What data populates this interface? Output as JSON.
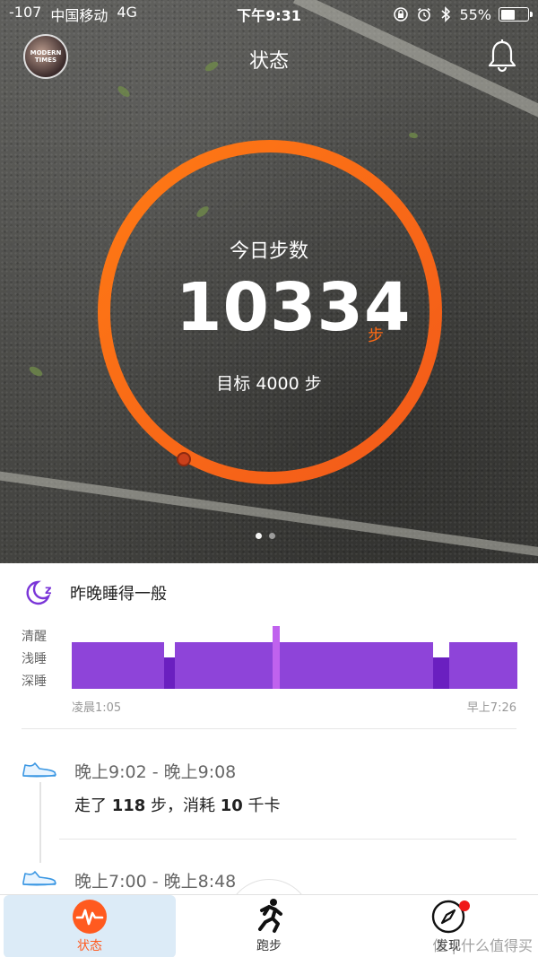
{
  "status_bar": {
    "signal": "-107",
    "carrier": "中国移动",
    "network": "4G",
    "time": "下午9:31",
    "battery": "55%",
    "battery_level": 0.55
  },
  "header": {
    "title": "状态",
    "avatar_text": "MODERN TIMES"
  },
  "steps": {
    "label": "今日步数",
    "value": "10334",
    "unit": "步",
    "goal": "目标 4000 步",
    "ring_color": "#ff6a14"
  },
  "sleep": {
    "title": "昨晚睡得一般",
    "levels": [
      "清醒",
      "浅睡",
      "深睡"
    ],
    "start": "凌晨1:05",
    "end": "早上7:26",
    "light_color": "#8e44d9",
    "deep_color": "#6a1fc0",
    "awake_color": "#c062ee"
  },
  "activities": [
    {
      "time": "晚上9:02 - 晚上9:08",
      "desc_prefix": "走了 ",
      "steps": "118",
      "desc_mid": " 步，消耗 ",
      "kcal": "10",
      "desc_suffix": " 千卡"
    },
    {
      "time": "晚上7:00 - 晚上8:48"
    }
  ],
  "tabs": [
    {
      "label": "状态"
    },
    {
      "label": "跑步"
    },
    {
      "label": "发现"
    }
  ],
  "watermark": "值 | 什么值得买"
}
